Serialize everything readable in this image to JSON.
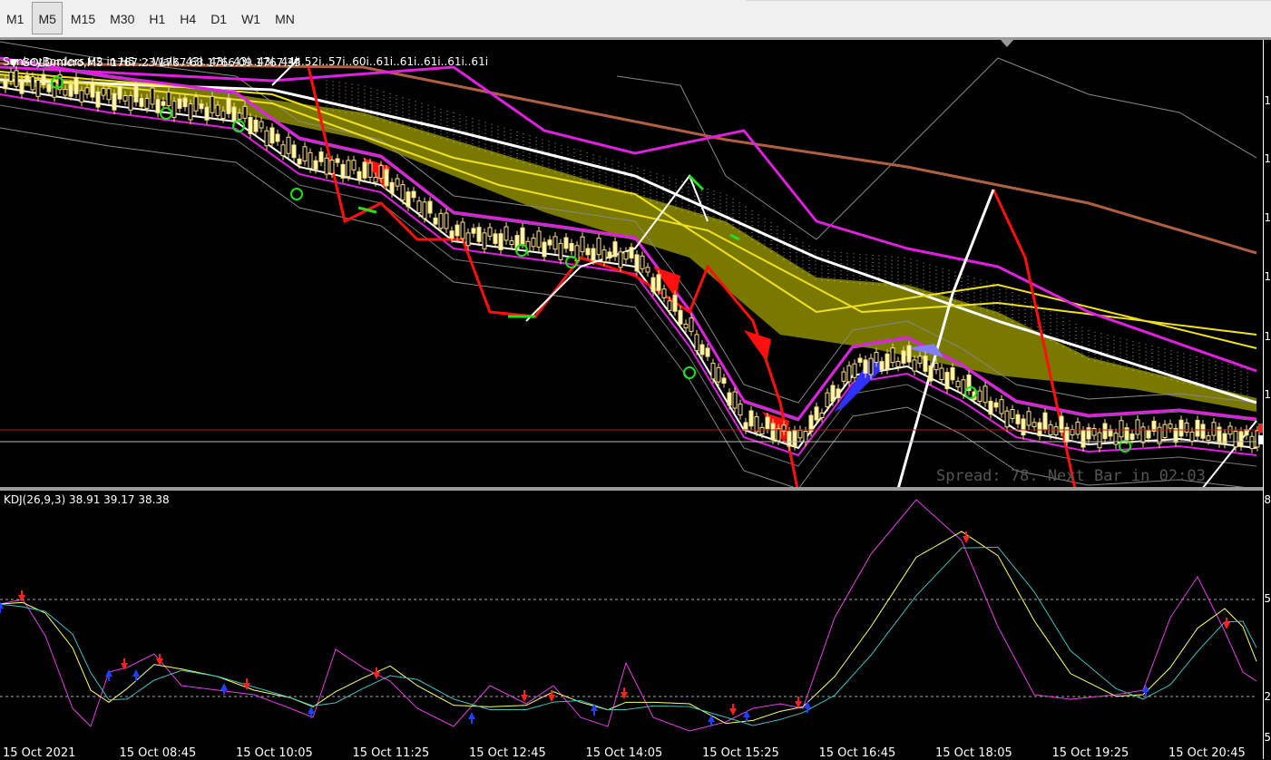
{
  "toolbar": {
    "timeframes": [
      {
        "label": "M1",
        "active": false
      },
      {
        "label": "M5",
        "active": true
      },
      {
        "label": "M15",
        "active": false
      },
      {
        "label": "M30",
        "active": false
      },
      {
        "label": "H1",
        "active": false
      },
      {
        "label": "H4",
        "active": false
      },
      {
        "label": "D1",
        "active": false
      },
      {
        "label": "W1",
        "active": false
      },
      {
        "label": "MN",
        "active": false
      }
    ]
  },
  "main_chart": {
    "symbol_line": "GOLDmicro,M5  1767.23 1767.63 1766.09 1767.39",
    "indicator_line": "SonkeyBorders H2 in H5 : : Walk..43i..43i..43i..43i..44i..52i..57i..60i..61i..61i..61i..61i..61i",
    "spread_text": "Spread: 78. Next Bar in 02:03",
    "right_axis_labels": [
      "1",
      "1",
      "1",
      "1",
      "1",
      "1",
      "1",
      "1",
      "1",
      "1"
    ]
  },
  "kdj": {
    "title": "KDJ(26,9,3) 38.91 39.17 38.38",
    "right_axis_labels": [
      "8",
      "5",
      "2",
      "5"
    ]
  },
  "time_axis": [
    "15 Oct 2021",
    "15 Oct 08:45",
    "15 Oct 10:05",
    "15 Oct 11:25",
    "15 Oct 12:45",
    "15 Oct 14:05",
    "15 Oct 15:25",
    "15 Oct 16:45",
    "15 Oct 18:05",
    "15 Oct 19:25",
    "15 Oct 20:45"
  ],
  "colors": {
    "background": "#000000",
    "cloud": "#808000",
    "k_line": "#e040e0",
    "d_line": "#ffff66",
    "j_line": "#40c0c0",
    "up_arrow": "#2040ff",
    "down_arrow": "#ff2020"
  }
}
